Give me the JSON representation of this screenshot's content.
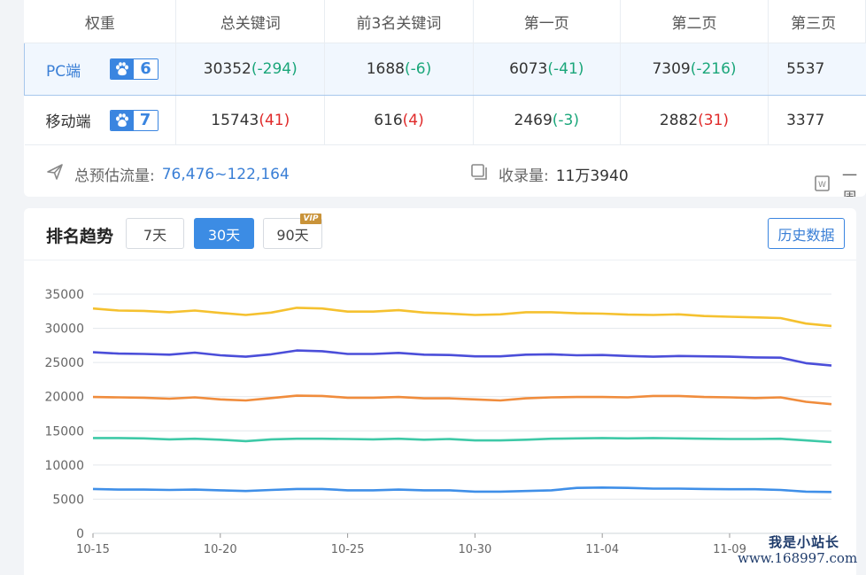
{
  "table": {
    "headers": [
      "权重",
      "总关键词",
      "前3名关键词",
      "第一页",
      "第二页",
      "第三页"
    ],
    "rows": [
      {
        "platform": "PC端",
        "weight": "6",
        "total": "30352",
        "total_delta": "(-294)",
        "top3": "1688",
        "top3_delta": "(-6)",
        "page1": "6073",
        "page1_delta": "(-41)",
        "page2": "7309",
        "page2_delta": "(-216)",
        "page3": "5537"
      },
      {
        "platform": "移动端",
        "weight": "7",
        "total": "15743",
        "total_delta": "(41)",
        "top3": "616",
        "top3_delta": "(4)",
        "page1": "2469",
        "page1_delta": "(-3)",
        "page2": "2882",
        "page2_delta": "(31)",
        "page3": "3377"
      }
    ]
  },
  "summary": {
    "traffic_label": "总预估流量:",
    "traffic_value": "76,476~122,164",
    "index_label": "收录量:",
    "index_value": "11万3940",
    "week_label": "一周"
  },
  "trend": {
    "title": "排名趋势",
    "ranges": [
      "7天",
      "30天",
      "90天"
    ],
    "active_range": "30天",
    "vip_badge": "VIP",
    "history_button": "历史数据"
  },
  "chart_data": {
    "type": "line",
    "x": [
      "10-15",
      "10-16",
      "10-17",
      "10-18",
      "10-19",
      "10-20",
      "10-21",
      "10-22",
      "10-23",
      "10-24",
      "10-25",
      "10-26",
      "10-27",
      "10-28",
      "10-29",
      "10-30",
      "10-31",
      "11-01",
      "11-02",
      "11-03",
      "11-04",
      "11-05",
      "11-06",
      "11-07",
      "11-08",
      "11-09",
      "11-10",
      "11-11",
      "11-12",
      "11-13"
    ],
    "x_tick_labels": [
      "10-15",
      "10-20",
      "10-25",
      "10-30",
      "11-04",
      "11-09"
    ],
    "ylim": [
      0,
      35000
    ],
    "y_ticks": [
      0,
      5000,
      10000,
      15000,
      20000,
      25000,
      30000,
      35000
    ],
    "grid": true,
    "series": [
      {
        "color": "#f5c12f",
        "values": [
          32900,
          32600,
          32550,
          32350,
          32600,
          32250,
          31950,
          32300,
          33000,
          32900,
          32450,
          32450,
          32650,
          32300,
          32150,
          31950,
          32050,
          32350,
          32350,
          32200,
          32150,
          32000,
          31950,
          32050,
          31800,
          31700,
          31600,
          31500,
          30700,
          30350
        ]
      },
      {
        "color": "#4b4ed9",
        "values": [
          26500,
          26300,
          26250,
          26150,
          26450,
          26050,
          25850,
          26200,
          26750,
          26650,
          26250,
          26250,
          26400,
          26150,
          26100,
          25900,
          25900,
          26150,
          26200,
          26050,
          26100,
          25950,
          25850,
          25950,
          25900,
          25850,
          25750,
          25700,
          24900,
          24550
        ]
      },
      {
        "color": "#f08c3c",
        "values": [
          19950,
          19900,
          19850,
          19700,
          19900,
          19600,
          19450,
          19800,
          20150,
          20100,
          19850,
          19850,
          19950,
          19750,
          19750,
          19600,
          19450,
          19750,
          19900,
          19950,
          19950,
          19900,
          20100,
          20100,
          19950,
          19900,
          19800,
          19900,
          19250,
          18900
        ]
      },
      {
        "color": "#3ec9a7",
        "values": [
          13950,
          13950,
          13900,
          13750,
          13850,
          13700,
          13500,
          13750,
          13850,
          13850,
          13800,
          13750,
          13850,
          13700,
          13800,
          13600,
          13600,
          13700,
          13850,
          13900,
          13950,
          13900,
          13950,
          13900,
          13850,
          13800,
          13800,
          13850,
          13600,
          13350
        ]
      },
      {
        "color": "#3f8fe8",
        "values": [
          6500,
          6400,
          6400,
          6350,
          6400,
          6300,
          6200,
          6350,
          6500,
          6500,
          6300,
          6300,
          6400,
          6300,
          6300,
          6100,
          6100,
          6200,
          6300,
          6650,
          6700,
          6650,
          6550,
          6550,
          6500,
          6450,
          6450,
          6350,
          6100,
          6050
        ]
      }
    ]
  },
  "watermark": {
    "line1": "我是小站长",
    "line2": "www.168997.com"
  }
}
